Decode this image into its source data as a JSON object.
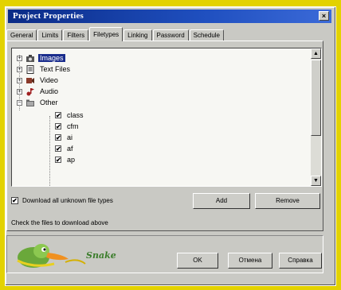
{
  "window": {
    "title": "Project Properties",
    "close_glyph": "×"
  },
  "tabs": [
    {
      "label": "General",
      "active": false
    },
    {
      "label": "Limits",
      "active": false
    },
    {
      "label": "Filters",
      "active": false
    },
    {
      "label": "Filetypes",
      "active": true
    },
    {
      "label": "Linking",
      "active": false
    },
    {
      "label": "Password",
      "active": false
    },
    {
      "label": "Schedule",
      "active": false
    }
  ],
  "tree": {
    "items": [
      {
        "label": "Images",
        "expander": "+",
        "icon": "camera-icon",
        "selected": true
      },
      {
        "label": "Text Files",
        "expander": "+",
        "icon": "text-file-icon",
        "selected": false
      },
      {
        "label": "Video",
        "expander": "+",
        "icon": "video-icon",
        "selected": false
      },
      {
        "label": "Audio",
        "expander": "+",
        "icon": "audio-icon",
        "selected": false
      },
      {
        "label": "Other",
        "expander": "−",
        "icon": "folder-icon",
        "selected": false
      }
    ],
    "children": [
      {
        "label": "class",
        "checked": true
      },
      {
        "label": "cfm",
        "checked": true
      },
      {
        "label": "ai",
        "checked": true
      },
      {
        "label": "af",
        "checked": true
      },
      {
        "label": "ap",
        "checked": true
      }
    ],
    "scroll_up_glyph": "▲",
    "scroll_down_glyph": "▼"
  },
  "options": {
    "download_unknown_label": "Download all unknown file types",
    "download_unknown_checked": true,
    "check_glyph": "✔"
  },
  "buttons": {
    "add": "Add",
    "remove": "Remove",
    "ok": "OK",
    "cancel": "Отмена",
    "help": "Справка"
  },
  "hint": "Check the files to download above",
  "brand": {
    "name": "Snake",
    "logo_icon": "duck-logo-icon"
  },
  "colors": {
    "accent": "#1a2d8c",
    "frame": "#e3d200",
    "logo_green": "#3a7d2a"
  }
}
